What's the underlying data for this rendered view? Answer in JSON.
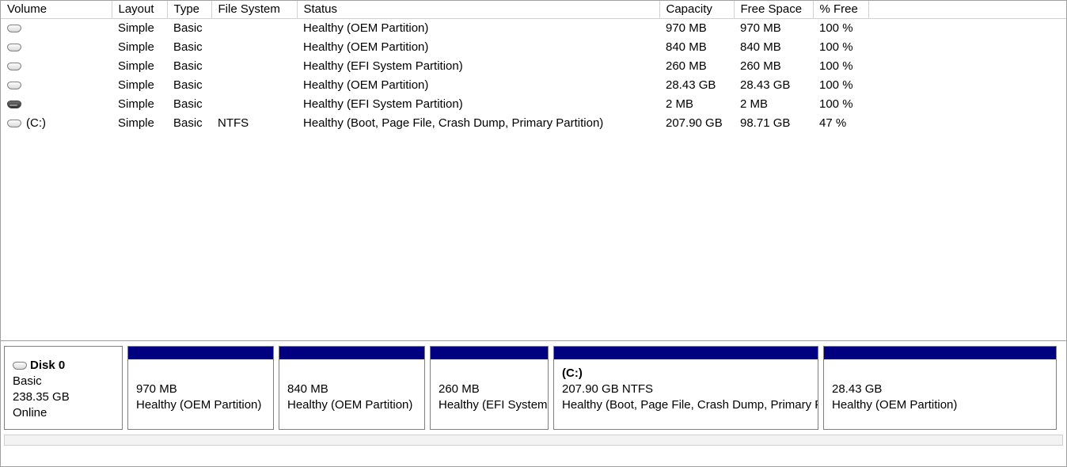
{
  "columns": {
    "volume": "Volume",
    "layout": "Layout",
    "type": "Type",
    "filesystem": "File System",
    "status": "Status",
    "capacity": "Capacity",
    "freespace": "Free Space",
    "pctfree": "% Free"
  },
  "volumes": [
    {
      "icon": "light",
      "name": "",
      "layout": "Simple",
      "type": "Basic",
      "fs": "",
      "status": "Healthy (OEM Partition)",
      "capacity": "970 MB",
      "free": "970 MB",
      "pct": "100 %"
    },
    {
      "icon": "light",
      "name": "",
      "layout": "Simple",
      "type": "Basic",
      "fs": "",
      "status": "Healthy (OEM Partition)",
      "capacity": "840 MB",
      "free": "840 MB",
      "pct": "100 %"
    },
    {
      "icon": "light",
      "name": "",
      "layout": "Simple",
      "type": "Basic",
      "fs": "",
      "status": "Healthy (EFI System Partition)",
      "capacity": "260 MB",
      "free": "260 MB",
      "pct": "100 %"
    },
    {
      "icon": "light",
      "name": "",
      "layout": "Simple",
      "type": "Basic",
      "fs": "",
      "status": "Healthy (OEM Partition)",
      "capacity": "28.43 GB",
      "free": "28.43 GB",
      "pct": "100 %"
    },
    {
      "icon": "dark",
      "name": "",
      "layout": "Simple",
      "type": "Basic",
      "fs": "",
      "status": "Healthy (EFI System Partition)",
      "capacity": "2 MB",
      "free": "2 MB",
      "pct": "100 %"
    },
    {
      "icon": "light",
      "name": "(C:)",
      "layout": "Simple",
      "type": "Basic",
      "fs": "NTFS",
      "status": "Healthy (Boot, Page File, Crash Dump, Primary Partition)",
      "capacity": "207.90 GB",
      "free": "98.71 GB",
      "pct": "47 %"
    }
  ],
  "disk": {
    "name": "Disk 0",
    "type": "Basic",
    "size": "238.35 GB",
    "state": "Online",
    "partitions": [
      {
        "letter": "",
        "size": "970 MB",
        "status": "Healthy (OEM Partition)",
        "flex": 185
      },
      {
        "letter": "",
        "size": "840 MB",
        "status": "Healthy (OEM Partition)",
        "flex": 185
      },
      {
        "letter": "",
        "size": "260 MB",
        "status": "Healthy (EFI System Partition)",
        "flex": 150
      },
      {
        "letter": "(C:)",
        "size": "207.90 GB NTFS",
        "status": "Healthy (Boot, Page File, Crash Dump, Primary Partition)",
        "flex": 335
      },
      {
        "letter": "",
        "size": "28.43 GB",
        "status": "Healthy (OEM Partition)",
        "flex": 295
      }
    ]
  }
}
